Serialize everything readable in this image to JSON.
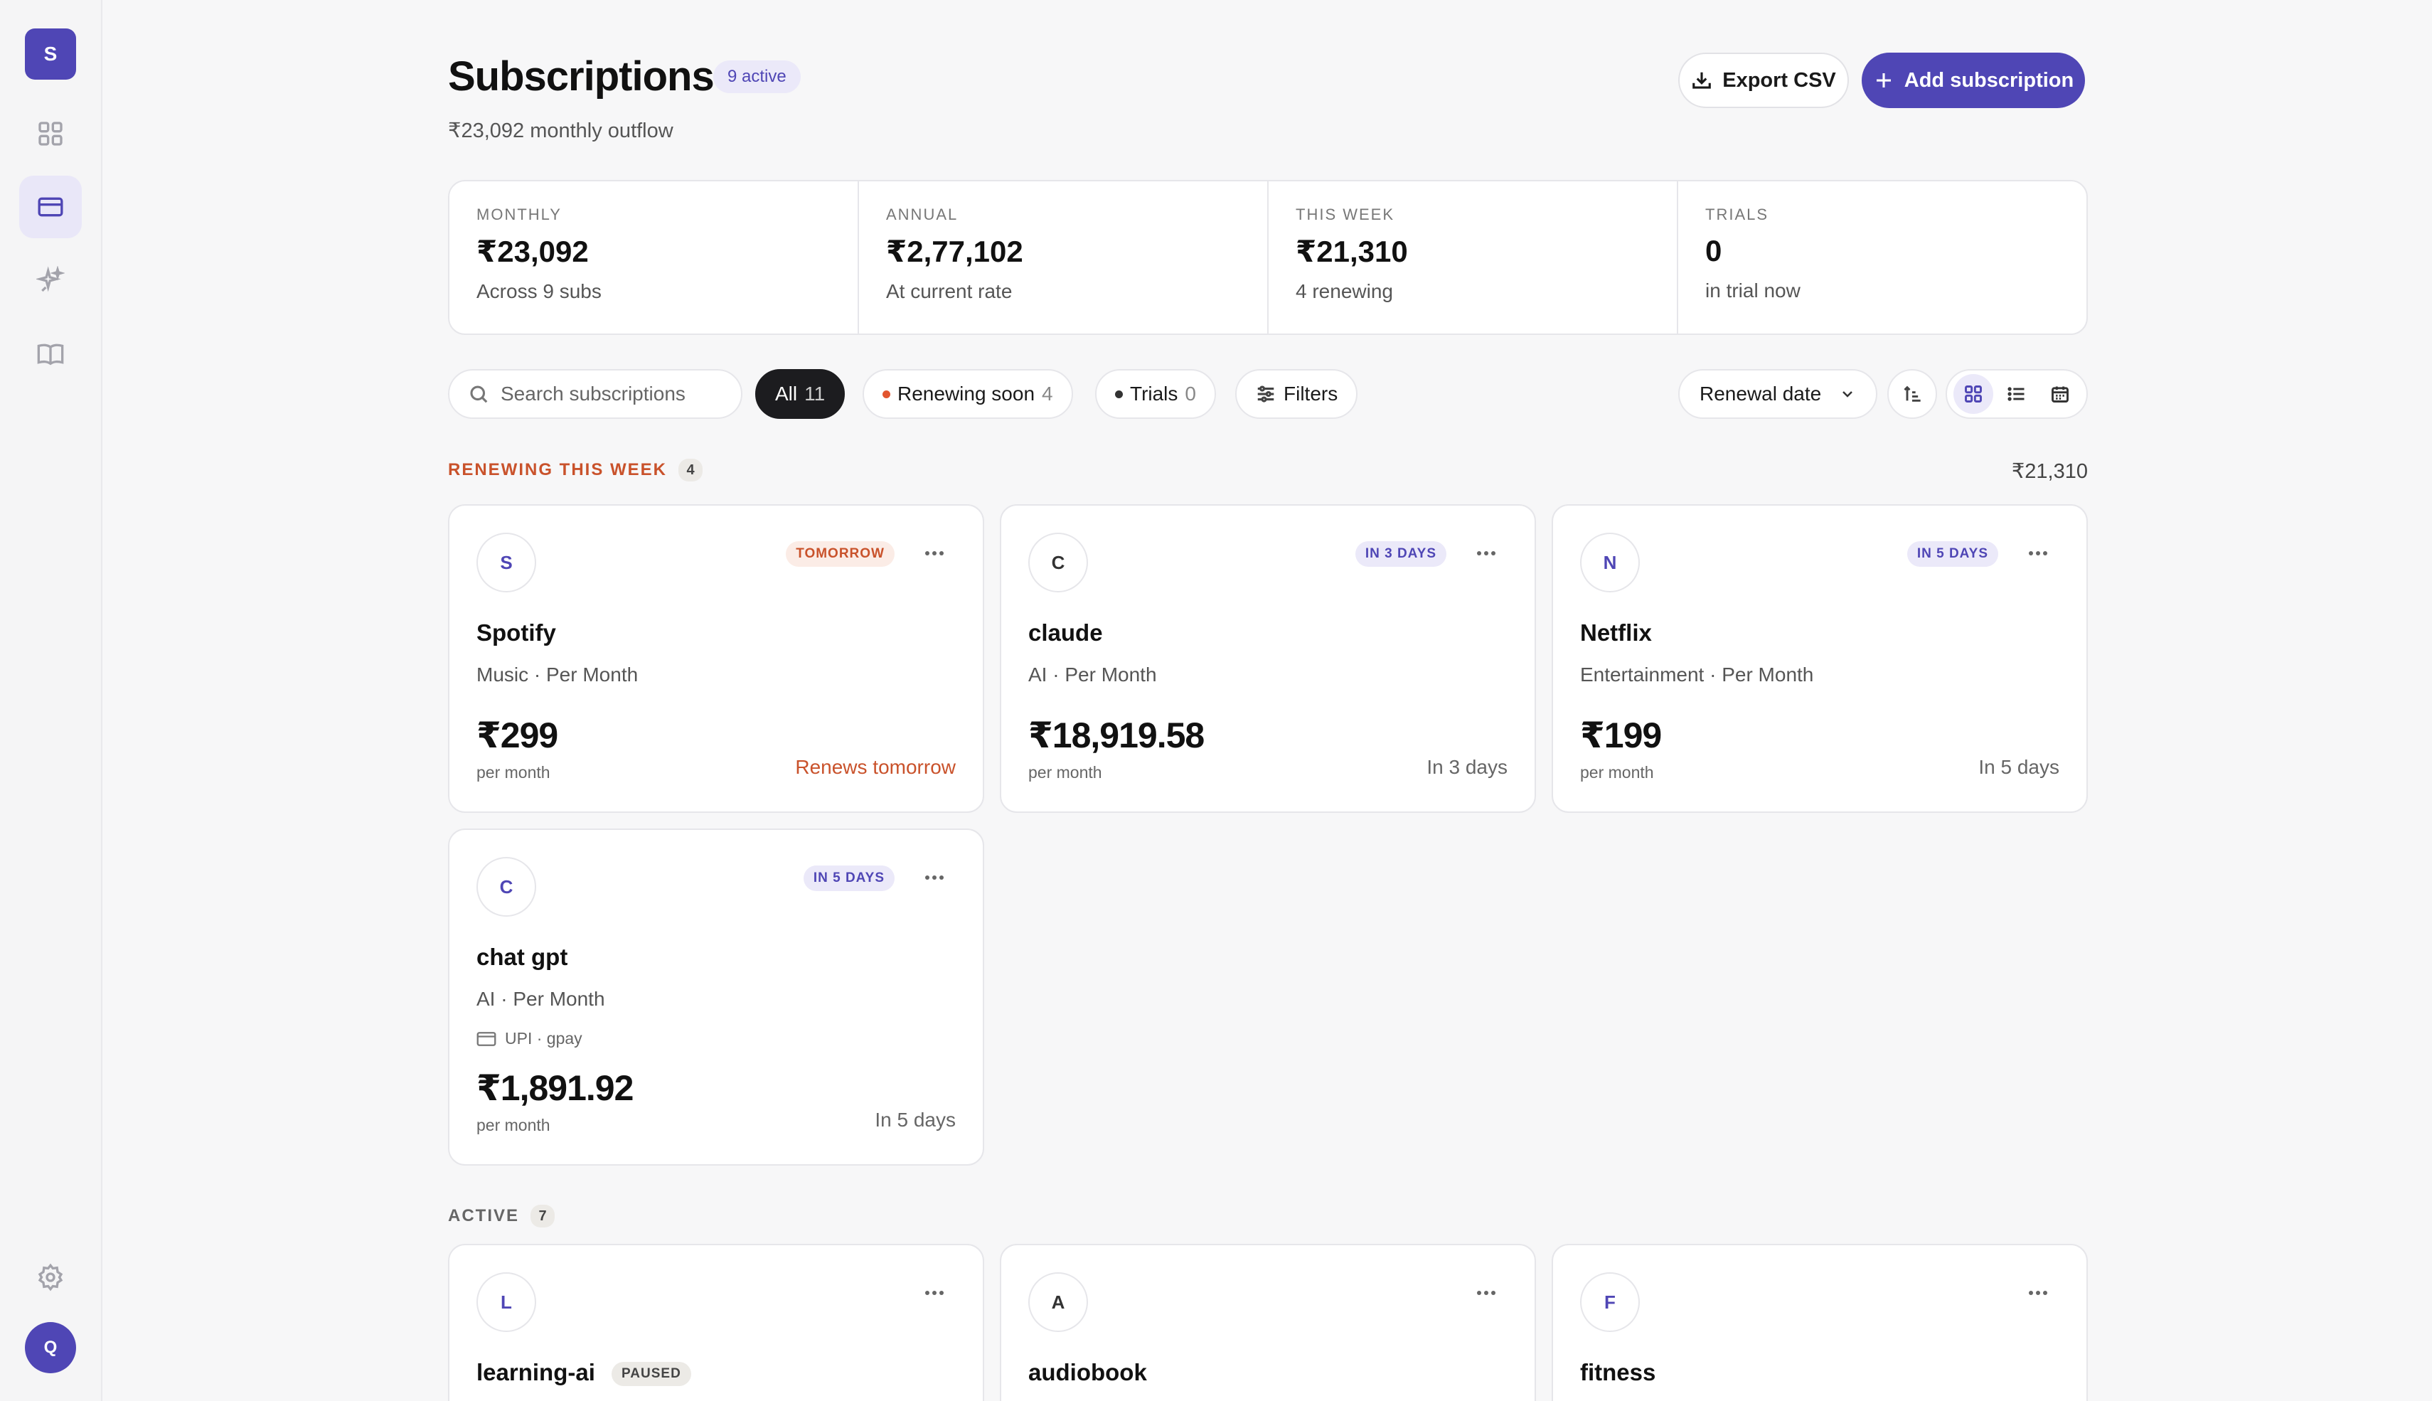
{
  "app": {
    "logo_letter": "S",
    "user_initial": "Q"
  },
  "sidebar": {
    "items": [
      {
        "name": "dashboard",
        "icon": "grid-icon"
      },
      {
        "name": "subscriptions",
        "icon": "card-icon",
        "active": true
      },
      {
        "name": "insights",
        "icon": "sparkle-icon"
      },
      {
        "name": "guide",
        "icon": "book-icon"
      }
    ],
    "settings_icon": "gear-icon"
  },
  "header": {
    "title": "Subscriptions",
    "active_badge": "9 active",
    "subtitle": "₹23,092 monthly outflow",
    "export_label": "Export CSV",
    "add_label": "Add subscription"
  },
  "stats": [
    {
      "label": "Monthly",
      "value": "₹23,092",
      "sub": "Across 9 subs"
    },
    {
      "label": "Annual",
      "value": "₹2,77,102",
      "sub": "At current rate"
    },
    {
      "label": "This week",
      "value": "₹21,310",
      "sub": "4 renewing"
    },
    {
      "label": "Trials",
      "value": "0",
      "sub": "in trial now"
    }
  ],
  "toolbar": {
    "search_placeholder": "Search subscriptions",
    "chips": [
      {
        "label": "All",
        "count": "11"
      },
      {
        "label": "Renewing soon",
        "count": "4"
      },
      {
        "label": "Trials",
        "count": "0"
      }
    ],
    "filters_label": "Filters",
    "sort_label": "Renewal date"
  },
  "sections": {
    "renewing": {
      "title": "Renewing this week",
      "count": "4",
      "total": "₹21,310"
    },
    "active": {
      "title": "Active",
      "count": "7"
    }
  },
  "renewing_cards": [
    {
      "initial": "S",
      "badge": "Tomorrow",
      "name": "Spotify",
      "meta": "Music · Per Month",
      "price": "₹299",
      "per": "per month",
      "renew": "Renews tomorrow"
    },
    {
      "initial": "C",
      "badge": "In 3 days",
      "name": "claude",
      "meta": "AI · Per Month",
      "price": "₹18,919.58",
      "per": "per month",
      "renew": "In 3 days"
    },
    {
      "initial": "N",
      "badge": "In 5 days",
      "name": "Netflix",
      "meta": "Entertainment · Per Month",
      "price": "₹199",
      "per": "per month",
      "renew": "In 5 days"
    },
    {
      "initial": "C",
      "badge": "In 5 days",
      "name": "chat gpt",
      "meta": "AI · Per Month",
      "payment": "UPI · gpay",
      "price": "₹1,891.92",
      "per": "per month",
      "renew": "In 5 days"
    }
  ],
  "active_cards": [
    {
      "initial": "L",
      "name": "learning-ai",
      "status": "Paused"
    },
    {
      "initial": "A",
      "name": "audiobook"
    },
    {
      "initial": "F",
      "name": "fitness"
    }
  ],
  "colors": {
    "accent": "#4f46b5",
    "warning": "#c9522b",
    "background": "#f7f7f8"
  }
}
